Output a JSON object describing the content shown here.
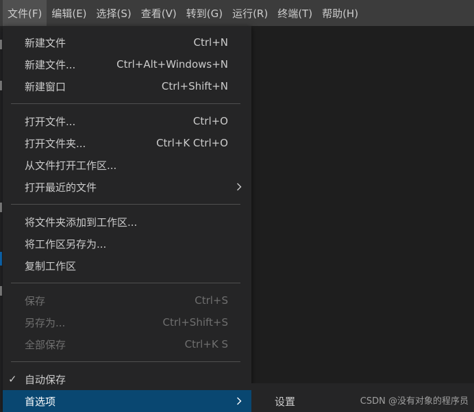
{
  "menubar": {
    "items": [
      {
        "label": "文件(F)"
      },
      {
        "label": "编辑(E)"
      },
      {
        "label": "选择(S)"
      },
      {
        "label": "查看(V)"
      },
      {
        "label": "转到(G)"
      },
      {
        "label": "运行(R)"
      },
      {
        "label": "终端(T)"
      },
      {
        "label": "帮助(H)"
      }
    ]
  },
  "file_menu": {
    "new_text_file": {
      "label": "新建文件",
      "shortcut": "Ctrl+N"
    },
    "new_file": {
      "label": "新建文件...",
      "shortcut": "Ctrl+Alt+Windows+N"
    },
    "new_window": {
      "label": "新建窗口",
      "shortcut": "Ctrl+Shift+N"
    },
    "open_file": {
      "label": "打开文件...",
      "shortcut": "Ctrl+O"
    },
    "open_folder": {
      "label": "打开文件夹...",
      "shortcut": "Ctrl+K Ctrl+O"
    },
    "open_workspace": {
      "label": "从文件打开工作区..."
    },
    "open_recent": {
      "label": "打开最近的文件"
    },
    "add_folder": {
      "label": "将文件夹添加到工作区..."
    },
    "save_workspace_as": {
      "label": "将工作区另存为..."
    },
    "duplicate_workspace": {
      "label": "复制工作区"
    },
    "save": {
      "label": "保存",
      "shortcut": "Ctrl+S"
    },
    "save_as": {
      "label": "另存为...",
      "shortcut": "Ctrl+Shift+S"
    },
    "save_all": {
      "label": "全部保存",
      "shortcut": "Ctrl+K S"
    },
    "auto_save": {
      "label": "自动保存",
      "check": "✓"
    },
    "preferences": {
      "label": "首选项"
    }
  },
  "submenu": {
    "settings": "设置"
  },
  "watermark": "CSDN @没有对象的程序员",
  "colors": {
    "menubar_bg": "#3c3c3c",
    "menu_bg": "#252526",
    "selected_bg": "#094771",
    "editor_bg": "#1e1e1e",
    "disabled_text": "#6f6f6f"
  }
}
